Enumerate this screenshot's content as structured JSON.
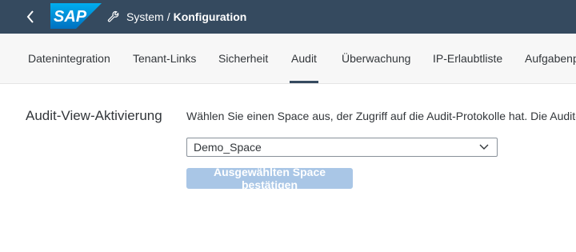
{
  "shell": {
    "logo_text": "SAP",
    "title_section": "System",
    "title_separator": "/",
    "title_page": "Konfiguration",
    "colors": {
      "shell_bg": "#354a5f",
      "logo_blue": "#0a6ed1"
    }
  },
  "tabs": [
    {
      "label": "Datenintegration",
      "active": false
    },
    {
      "label": "Tenant-Links",
      "active": false
    },
    {
      "label": "Sicherheit",
      "active": false
    },
    {
      "label": "Audit",
      "active": true
    },
    {
      "label": "Überwachung",
      "active": false
    },
    {
      "label": "IP-Erlaubtliste",
      "active": false
    },
    {
      "label": "Aufgabenp",
      "active": false
    }
  ],
  "audit": {
    "section_label": "Audit-View-Aktivierung",
    "description": "Wählen Sie einen Space aus, der Zugriff auf die Audit-Protokolle hat. Die Audit-Pr",
    "space_select_value": "Demo_Space",
    "confirm_button": "Ausgewählten Space bestätigen"
  }
}
